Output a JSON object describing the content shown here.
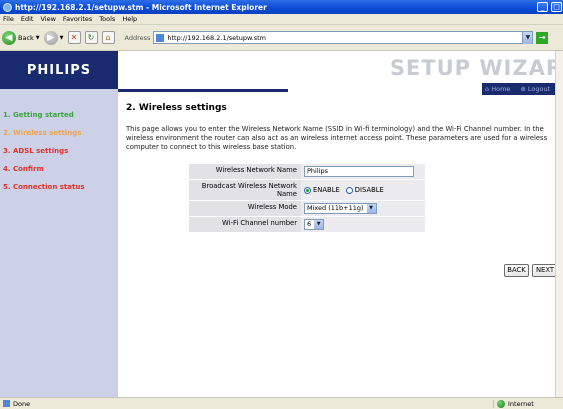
{
  "window": {
    "title": "http://192.168.2.1/setupw.stm - Microsoft Internet Explorer"
  },
  "menu": [
    "File",
    "Edit",
    "View",
    "Favorites",
    "Tools",
    "Help"
  ],
  "toolbar": {
    "back_label": "Back",
    "address_label": "Address",
    "address_value": "http://192.168.2.1/setupw.stm"
  },
  "header": {
    "logo": "PHILIPS",
    "banner": "SETUP WIZAR",
    "home_link": "Home",
    "logout_link": "Logout"
  },
  "sidebar": {
    "items": [
      {
        "label": "1. Getting started",
        "color": "#3aa63a"
      },
      {
        "label": "2. Wireless settings",
        "color": "#f2a24a"
      },
      {
        "label": "3. ADSL settings",
        "color": "#e0302a"
      },
      {
        "label": "4. Confirm",
        "color": "#e0302a"
      },
      {
        "label": "5. Connection status",
        "color": "#e0302a"
      }
    ]
  },
  "main": {
    "title": "2. Wireless settings",
    "description": "This page allows you to enter the Wireless Network Name (SSID in Wi-fi terminology) and the Wi-Fi Channel number. In the wireless environment the router can also act as an wireless internet access point. These parameters are used for a wireless computer to connect to this wireless base station."
  },
  "form": {
    "network_name_label": "Wireless Network Name",
    "network_name_value": "Philips",
    "broadcast_label": "Broadcast Wireless Network Name",
    "enable_label": "ENABLE",
    "disable_label": "DISABLE",
    "broadcast_selected": "ENABLE",
    "mode_label": "Wireless Mode",
    "mode_value": "Mixed (11b+11g)",
    "channel_label": "Wi-Fi Channel number",
    "channel_value": "6"
  },
  "buttons": {
    "back": "BACK",
    "next": "NEXT"
  },
  "status": {
    "left": "Done",
    "zone": "Internet"
  }
}
